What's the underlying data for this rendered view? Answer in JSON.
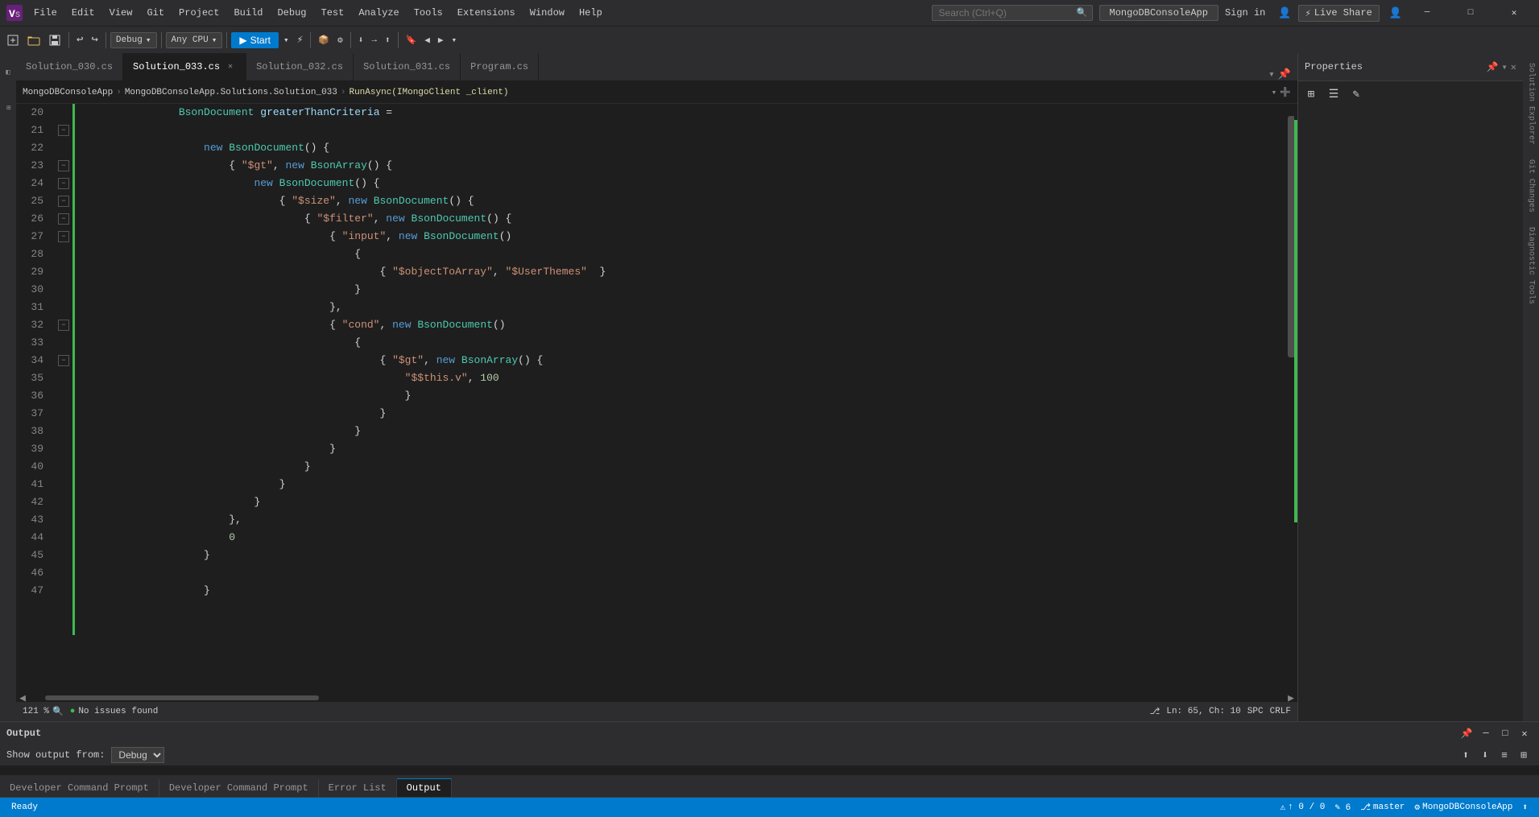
{
  "titleBar": {
    "appName": "MongoDBConsoleApp",
    "menuItems": [
      "File",
      "Edit",
      "View",
      "Git",
      "Project",
      "Build",
      "Debug",
      "Test",
      "Analyze",
      "Tools",
      "Extensions",
      "Window",
      "Help"
    ],
    "searchPlaceholder": "Search (Ctrl+Q)",
    "signIn": "Sign in",
    "liveShare": "Live Share",
    "winMinimize": "─",
    "winMaximize": "□",
    "winClose": "✕"
  },
  "toolbar": {
    "debugMode": "Debug",
    "platform": "Any CPU",
    "startLabel": "Start",
    "undoRedo": "↩ ↪"
  },
  "tabs": [
    {
      "id": "tab1",
      "label": "Solution_030.cs",
      "active": false,
      "modified": false
    },
    {
      "id": "tab2",
      "label": "Solution_033.cs",
      "active": true,
      "modified": true
    },
    {
      "id": "tab3",
      "label": "Solution_032.cs",
      "active": false,
      "modified": false
    },
    {
      "id": "tab4",
      "label": "Solution_031.cs",
      "active": false,
      "modified": false
    },
    {
      "id": "tab5",
      "label": "Program.cs",
      "active": false,
      "modified": false
    }
  ],
  "breadcrumb": {
    "project": "MongoDBConsoleApp",
    "class": "MongoDBConsoleApp.Solutions.Solution_033",
    "method": "RunAsync(IMongoClient _client)"
  },
  "editor": {
    "lines": [
      {
        "num": 20,
        "content": "                BsonDocument greaterThanCriteria ="
      },
      {
        "num": 21,
        "content": ""
      },
      {
        "num": 22,
        "content": "                    new BsonDocument() {"
      },
      {
        "num": 23,
        "content": "                        { \"$gt\", new BsonArray() {"
      },
      {
        "num": 24,
        "content": "                            new BsonDocument() {"
      },
      {
        "num": 25,
        "content": "                                { \"$size\", new BsonDocument() {"
      },
      {
        "num": 26,
        "content": "                                    { \"$filter\", new BsonDocument() {"
      },
      {
        "num": 27,
        "content": "                                        { \"input\", new BsonDocument()"
      },
      {
        "num": 28,
        "content": "                                            {"
      },
      {
        "num": 29,
        "content": "                                                { \"$objectToArray\", \"$UserThemes\"  }"
      },
      {
        "num": 30,
        "content": "                                            }"
      },
      {
        "num": 31,
        "content": "                                        },"
      },
      {
        "num": 32,
        "content": "                                        { \"cond\", new BsonDocument()"
      },
      {
        "num": 33,
        "content": "                                            {"
      },
      {
        "num": 34,
        "content": "                                                { \"$gt\", new BsonArray() {"
      },
      {
        "num": 35,
        "content": "                                                    \"$$this.v\", 100"
      },
      {
        "num": 36,
        "content": "                                                    }"
      },
      {
        "num": 37,
        "content": "                                                }"
      },
      {
        "num": 38,
        "content": "                                            }"
      },
      {
        "num": 39,
        "content": "                                        }"
      },
      {
        "num": 40,
        "content": "                                    }"
      },
      {
        "num": 41,
        "content": "                                }"
      },
      {
        "num": 42,
        "content": "                            }"
      },
      {
        "num": 43,
        "content": "                        },"
      },
      {
        "num": 44,
        "content": "                        0"
      },
      {
        "num": 45,
        "content": "                    }"
      },
      {
        "num": 46,
        "content": ""
      }
    ],
    "zoom": "121 %",
    "issues": "No issues found",
    "cursorLine": "65",
    "cursorCol": "10",
    "encoding": "SPC",
    "lineEnding": "CRLF"
  },
  "properties": {
    "title": "Properties"
  },
  "outputPanel": {
    "title": "Output",
    "showOutputFrom": "Show output from:",
    "source": "Debug",
    "tabs": [
      {
        "label": "Developer Command Prompt",
        "active": false
      },
      {
        "label": "Developer Command Prompt",
        "active": false
      },
      {
        "label": "Error List",
        "active": false
      },
      {
        "label": "Output",
        "active": true
      }
    ]
  },
  "statusBar": {
    "ready": "Ready",
    "gitBranch": "master",
    "errors": "0",
    "warnings": "0",
    "cursor": "Ln: 65",
    "col": "Ch: 10",
    "encoding": "SPC",
    "lineEnding": "CRLF",
    "projectName": "MongoDBConsoleApp",
    "lineCount": "6"
  },
  "rightActivity": {
    "items": [
      "Solution Explorer",
      "Git Changes",
      "Diagnostic Tools"
    ]
  }
}
